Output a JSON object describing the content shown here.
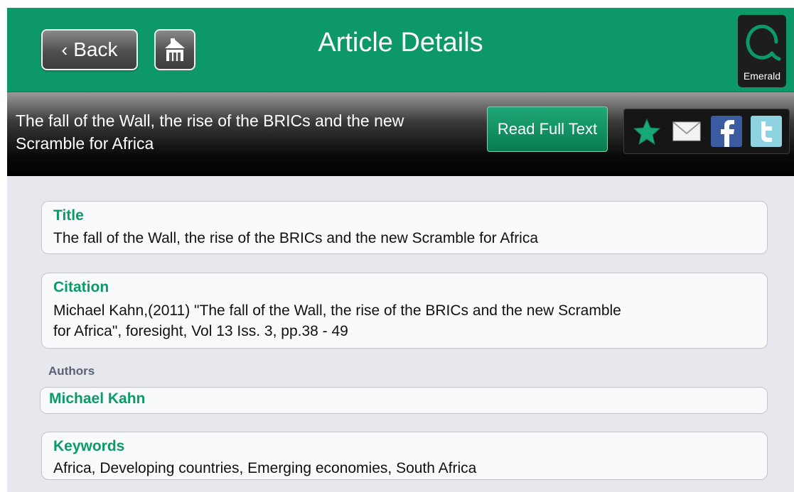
{
  "navbar": {
    "back_label": "Back",
    "title": "Article Details",
    "logo_text": "Emerald",
    "icons": {
      "back": "chevron-left-icon",
      "home": "home-icon"
    }
  },
  "subheader": {
    "article_title": "The fall of the Wall, the rise of the BRICs and the new Scramble for Africa",
    "read_full_text_label": "Read Full Text",
    "share_icons": [
      "star-icon",
      "mail-icon",
      "facebook-icon",
      "twitter-icon"
    ]
  },
  "details": {
    "title_label": "Title",
    "title_value": "The fall of the Wall, the rise of the BRICs and the new Scramble for Africa",
    "citation_label": "Citation",
    "citation_line1": "Michael Kahn,(2011) \"The fall of the Wall, the rise of the BRICs and the new Scramble",
    "citation_line2": "for Africa\", foresight, Vol 13 Iss. 3, pp.38 - 49",
    "authors_label": "Authors",
    "authors": [
      "Michael Kahn"
    ],
    "keywords_label": "Keywords",
    "keywords_value": "Africa, Developing countries, Emerging economies, South Africa"
  },
  "colors": {
    "brand_green": "#0d9868",
    "label_green": "#0b9a68",
    "section_gray": "#5b6275",
    "background": "#e6e8ee"
  }
}
